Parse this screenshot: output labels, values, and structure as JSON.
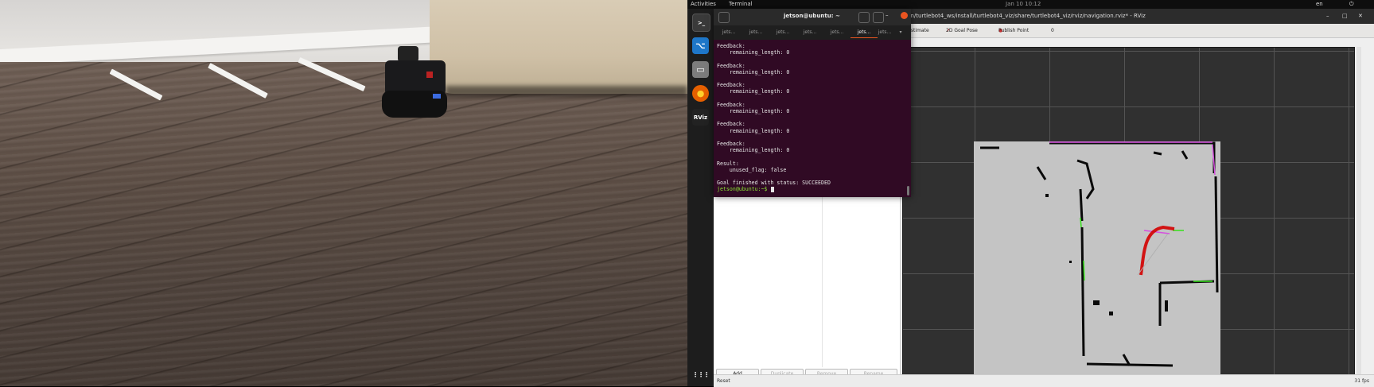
{
  "topbar": {
    "activities": "Activities",
    "app_menu": "Terminal",
    "clock": "Jan 10  10:12",
    "status": "en"
  },
  "dock": {
    "items": [
      {
        "name": "terminal",
        "glyph": ">_"
      },
      {
        "name": "vscode",
        "glyph": "⌥"
      },
      {
        "name": "files",
        "glyph": "▭"
      },
      {
        "name": "firefox",
        "glyph": "●"
      },
      {
        "name": "rviz",
        "glyph": "RViz"
      },
      {
        "name": "apps-grid",
        "glyph": "⋮⋮⋮"
      }
    ]
  },
  "terminal": {
    "title": "jetson@ubuntu: ~",
    "tabs": [
      "jets...",
      "jets...",
      "jets...",
      "jets...",
      "jets...",
      "jets...",
      "jets..."
    ],
    "active_tab": 5,
    "lines": [
      "Feedback:",
      "    remaining_length: 0",
      "",
      "Feedback:",
      "    remaining_length: 0",
      "",
      "Feedback:",
      "    remaining_length: 0",
      "",
      "Feedback:",
      "    remaining_length: 0",
      "",
      "Feedback:",
      "    remaining_length: 0",
      "",
      "Feedback:",
      "    remaining_length: 0",
      "",
      "Result:",
      "    unused_flag: false",
      "",
      "Goal finished with status: SUCCEEDED"
    ],
    "prompt": "jetson@ubuntu:~$ "
  },
  "rviz": {
    "title": "/home/jetson/turtlebot4_ws/install/turtlebot4_viz/share/turtlebot4_viz/rviz/navigation.rviz* - RViz",
    "toolbar": [
      "2D Pose Estimate",
      "2D Goal Pose",
      "Publish Point"
    ],
    "toolbar_extra": "0",
    "panel_buttons": [
      {
        "label": "Add",
        "enabled": true
      },
      {
        "label": "Duplicate",
        "enabled": false
      },
      {
        "label": "Remove",
        "enabled": false
      },
      {
        "label": "Rename",
        "enabled": false
      }
    ],
    "status": "Reset",
    "fps": "31 fps"
  },
  "map_colors": {
    "free": "#c4c4c4",
    "wall": "#0a0a0a",
    "path": "#d40000",
    "laser": "#35e11b",
    "costmap": "#d64ee0"
  }
}
